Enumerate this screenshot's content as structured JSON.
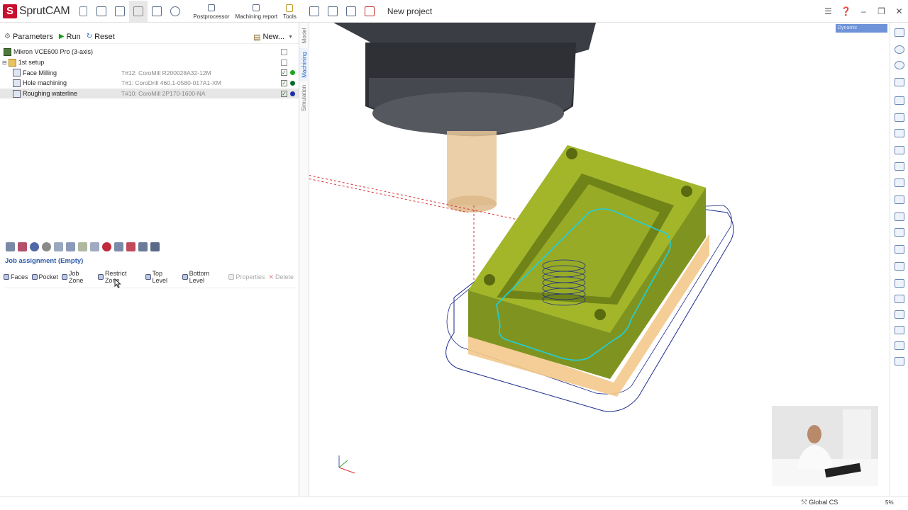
{
  "app": {
    "logo_s": "S",
    "title": "SprutCAM",
    "document": "New project"
  },
  "toolbar": {
    "postprocessor": "Postprocessor",
    "machining_report": "Machining report",
    "tools": "Tools"
  },
  "left": {
    "parameters": "Parameters",
    "run": "Run",
    "reset": "Reset",
    "new": "New...",
    "machine": "Mikron VCE600 Pro (3-axis)",
    "setup": "1st setup",
    "operations": [
      {
        "name": "Face Milling",
        "tool": "T#12: CoroMill R200028A32-12M",
        "status_color": "#1aa51a"
      },
      {
        "name": "Hole machining",
        "tool": "T#1: CoroDrill 460.1-0580-017A1-XM",
        "status_color": "#0d6b2a"
      },
      {
        "name": "Roughing waterline",
        "tool": "T#10: CoroMill 2P170-1600-NA",
        "status_color": "#1c2ea8"
      }
    ],
    "job_title": "Job assignment  (Empty)",
    "job_buttons": [
      "Faces",
      "Pocket",
      "Job Zone",
      "Restrict Zone",
      "Top Level",
      "Bottom Level",
      "Properties",
      "Delete"
    ]
  },
  "vtabs": {
    "model": "Model",
    "machining": "Machining",
    "simulation": "Simulation"
  },
  "viewport": {
    "mode": "Dynamic"
  },
  "status": {
    "cs": "Global CS",
    "zoom": "5%"
  },
  "colors": {
    "accent": "#2a6ac8",
    "part": "#8a9e22",
    "toolpath": "#1fd0df"
  }
}
